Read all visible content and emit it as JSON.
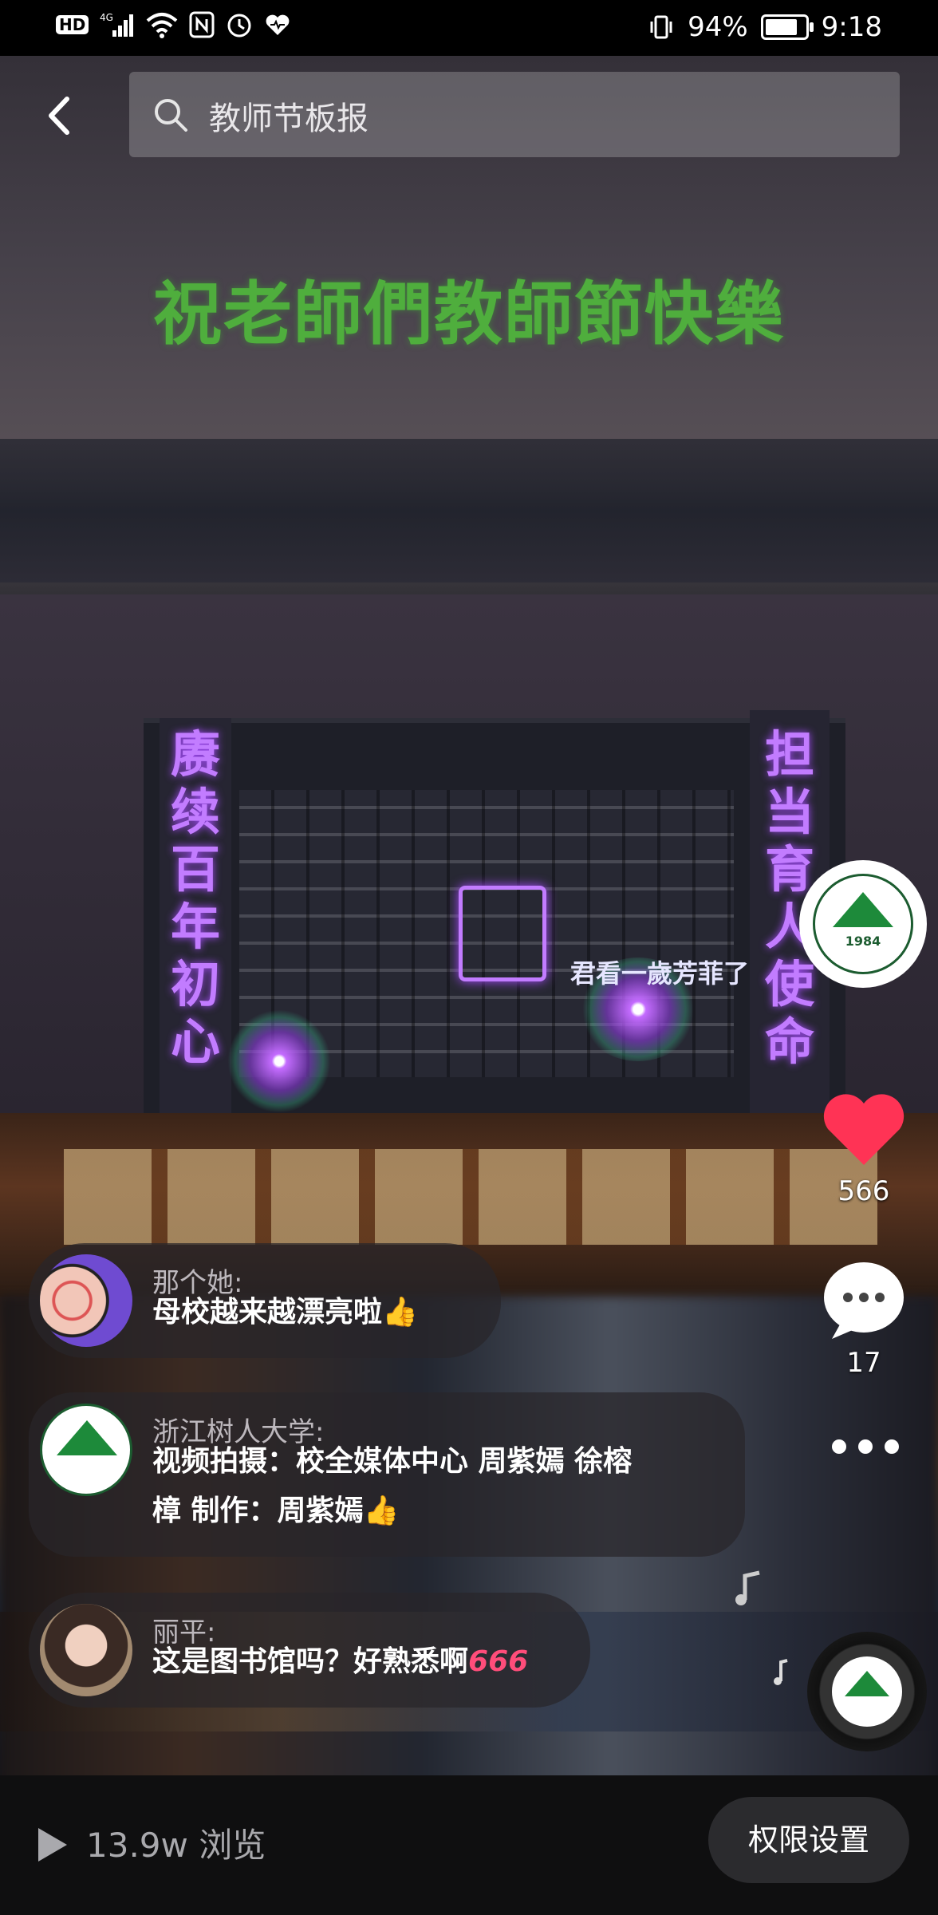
{
  "status_bar": {
    "left_icons": [
      "hd-icon",
      "signal-4g-icon",
      "wifi-icon",
      "nfc-icon",
      "alarm-icon",
      "health-icon"
    ],
    "hd_label": "HD",
    "battery_percent": "94%",
    "battery_level": 0.94,
    "time": "9:18"
  },
  "header": {
    "back_icon": "chevron-left-icon",
    "search_icon": "search-icon",
    "search_text": "教师节板报"
  },
  "video": {
    "banner_text": "祝老師們教師節快樂",
    "left_facade_text": "赓续百年初心",
    "right_facade_text": "担当育人使命",
    "slogan_text": "君看一歲芳菲了"
  },
  "account": {
    "badge_year": "1984"
  },
  "actions": {
    "likes": "566",
    "comments": "17",
    "like_color": "#ff3355"
  },
  "comments": [
    {
      "name": "那个她:",
      "text": "母校越来越漂亮啦👍"
    },
    {
      "name": "浙江树人大学:",
      "text_line1": "视频拍摄：校全媒体中心 周紫嫣 徐榕",
      "text_line2": "樟 制作：周紫嫣👍"
    },
    {
      "name": "丽平:",
      "text": "这是图书馆吗？好熟悉啊",
      "tag": "666"
    }
  ],
  "bottom": {
    "views": "13.9w 浏览",
    "permission_button": "权限设置"
  }
}
